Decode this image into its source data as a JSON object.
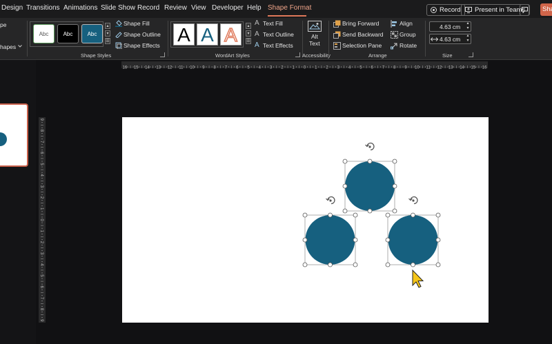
{
  "tabs": [
    {
      "label": "Design"
    },
    {
      "label": "Transitions"
    },
    {
      "label": "Animations"
    },
    {
      "label": "Slide Show"
    },
    {
      "label": "Record"
    },
    {
      "label": "Review"
    },
    {
      "label": "View"
    },
    {
      "label": "Developer"
    },
    {
      "label": "Help"
    },
    {
      "label": "Shape Format",
      "active": true
    }
  ],
  "titlebar": {
    "record_label": "Record",
    "present_label": "Present in Teams",
    "share_label": "Sha"
  },
  "ribbon": {
    "left_partial_top": "pe",
    "left_partial_bottom": "hapes",
    "shape_styles": {
      "swatch_labels": [
        "Abc",
        "Abc",
        "Abc"
      ],
      "fill_label": "Shape Fill",
      "outline_label": "Shape Outline",
      "effects_label": "Shape Effects",
      "group_label": "Shape Styles"
    },
    "wordart": {
      "letters": [
        "A",
        "A",
        "A"
      ],
      "text_fill": "Text Fill",
      "text_outline": "Text Outline",
      "text_effects": "Text Effects",
      "group_label": "WordArt Styles"
    },
    "accessibility": {
      "alt_text_line1": "Alt",
      "alt_text_line2": "Text",
      "group_label": "Accessibility"
    },
    "arrange": {
      "bring_forward": "Bring Forward",
      "send_backward": "Send Backward",
      "selection_pane": "Selection Pane",
      "align": "Align",
      "group": "Group",
      "rotate": "Rotate",
      "group_label": "Arrange"
    },
    "size": {
      "height_value": "4.63 cm",
      "width_value": "4.63 cm",
      "group_label": "Size"
    }
  },
  "rulers": {
    "horizontal_labels": [
      "16",
      "15",
      "14",
      "13",
      "12",
      "11",
      "10",
      "9",
      "8",
      "7",
      "6",
      "5",
      "4",
      "3",
      "2",
      "1",
      "0",
      "1",
      "2",
      "3",
      "4",
      "5",
      "6",
      "7",
      "8",
      "9",
      "10",
      "11",
      "12",
      "13",
      "14",
      "15",
      "16"
    ],
    "vertical_labels": [
      "9",
      "8",
      "7",
      "6",
      "5",
      "4",
      "3",
      "2",
      "1",
      "0",
      "1",
      "2",
      "3",
      "4",
      "5",
      "6",
      "7",
      "8",
      "9"
    ]
  },
  "colors": {
    "circle_fill": "#16607f",
    "accent": "#e0795a",
    "cursor": "#f5c518"
  },
  "icons": {
    "rotate": "rotate-handle-icon",
    "cursor": "mouse-pointer-icon"
  }
}
